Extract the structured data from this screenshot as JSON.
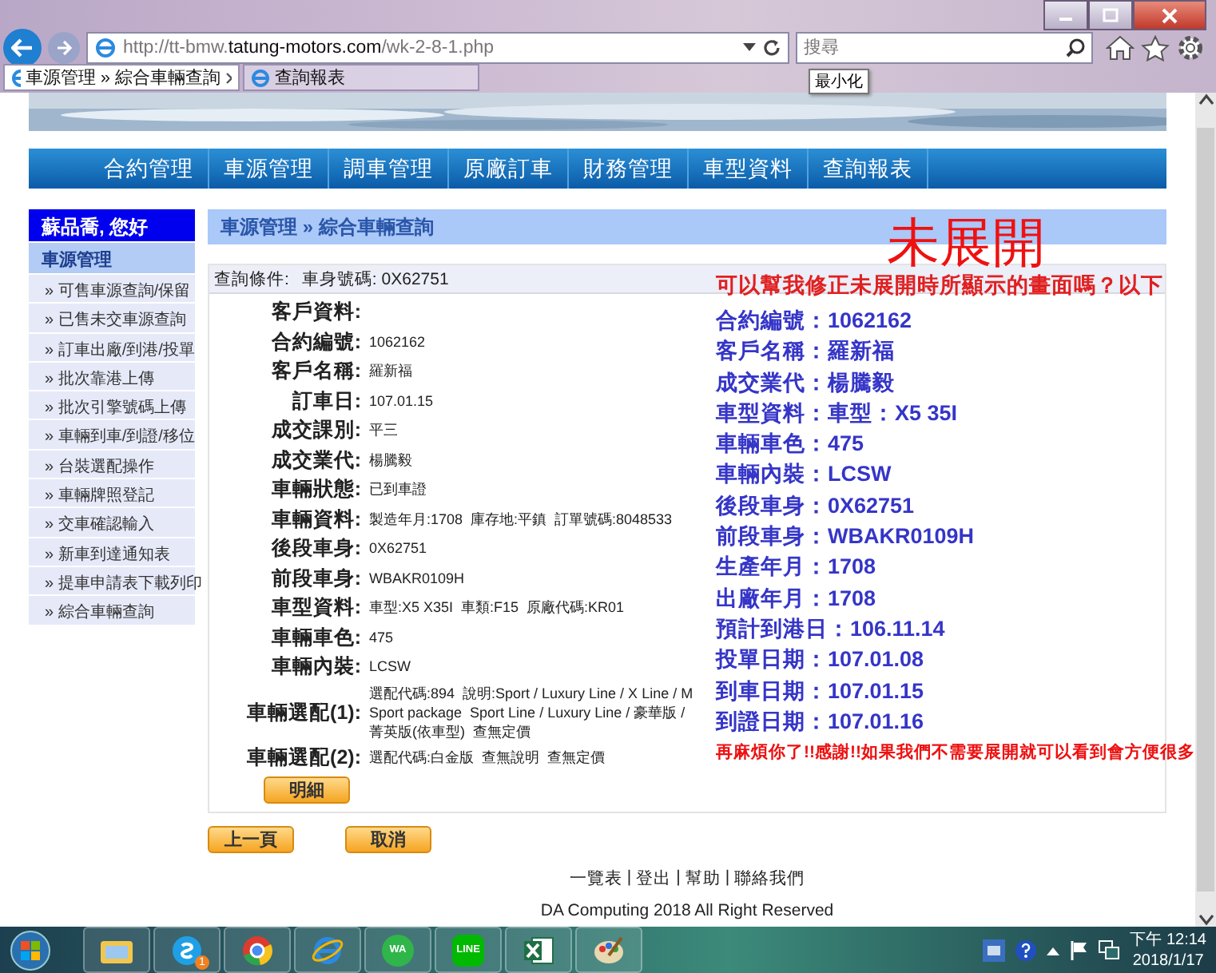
{
  "browser": {
    "url": "http://tt-bmw.**tatung-motors.com**/wk-2-8-1.php",
    "search": {
      "placeholder": "搜尋"
    },
    "tooltip": "最小化",
    "tabs": [
      {
        "label": "車源管理 » 綜合車輛查詢",
        "selected": true
      },
      {
        "label": "查詢報表",
        "selected": false
      }
    ]
  },
  "nav": [
    "合約管理",
    "車源管理",
    "調車管理",
    "原廠訂車",
    "財務管理",
    "車型資料",
    "查詢報表"
  ],
  "sidebar": {
    "greeting": "蘇品喬, 您好",
    "section": "車源管理",
    "items": [
      "» 可售車源查詢/保留",
      "» 已售未交車源查詢",
      "» 訂車出廠/到港/投單",
      "» 批次靠港上傳",
      "» 批次引擎號碼上傳",
      "» 車輛到車/到證/移位",
      "» 台裝選配操作",
      "» 車輛牌照登記",
      "» 交車確認輸入",
      "» 新車到達通知表",
      "» 提車申請表下載列印",
      "» 綜合車輛查詢"
    ]
  },
  "breadcrumb": "車源管理 » 綜合車輛查詢",
  "query": {
    "label": "查詢條件:",
    "value": "車身號碼: 0X62751"
  },
  "fields": [
    {
      "label": "客戶資料:"
    },
    {
      "label": "合約編號:",
      "value": "1062162"
    },
    {
      "label": "客戶名稱:",
      "value": "羅新福"
    },
    {
      "label": "訂車日:",
      "value": "107.01.15"
    },
    {
      "label": "成交課別:",
      "value": "平三"
    },
    {
      "label": "成交業代:",
      "value": "楊騰毅"
    },
    {
      "label": "車輛狀態:",
      "value": "已到車證"
    },
    {
      "label": "車輛資料:",
      "value": "製造年月:1708  庫存地:平鎮  訂單號碼:8048533"
    },
    {
      "label": "後段車身:",
      "value": "0X62751"
    },
    {
      "label": "前段車身:",
      "value": "WBAKR0109H"
    },
    {
      "label": "車型資料:",
      "value": "車型:X5 X35I  車類:F15  原廠代碼:KR01"
    },
    {
      "label": "車輛車色:",
      "value": "475"
    },
    {
      "label": "車輛內裝:",
      "value": "LCSW"
    },
    {
      "label": "車輛選配(1):",
      "value": "選配代碼:894  說明:Sport / Luxury Line / X Line / M Sport package  Sport Line / Luxury Line / 豪華版 / 菁英版(依車型)  查無定價"
    },
    {
      "label": "車輛選配(2):",
      "value": "選配代碼:白金版  查無說明  查無定價"
    }
  ],
  "detail_button": "明細",
  "buttons": [
    "上一頁",
    "取消"
  ],
  "footer_links": [
    "一覽表",
    "登出",
    "幫助",
    "聯絡我們"
  ],
  "footer_separator": "|",
  "copyright": "DA Computing 2018 All Right Reserved",
  "annotation": {
    "title": "未展開",
    "question": "可以幫我修正未展開時所顯示的畫面嗎？以下",
    "lines": [
      "合約編號：1062162",
      "客戶名稱：羅新福",
      "成交業代：楊騰毅",
      "車型資料：車型：X5 35I",
      "車輛車色：475",
      "車輛內裝：LCSW",
      "後段車身：0X62751",
      "前段車身：WBAKR0109H",
      "生產年月：1708",
      "出廠年月：1708",
      "預計到港日：106.11.14",
      "投單日期：107.01.08",
      "到車日期：107.01.15",
      "到證日期：107.01.16"
    ],
    "closing": "再麻煩你了!!感謝!!如果我們不需要展開就可以看到會方便很多"
  },
  "taskbar": {
    "apps": [
      {
        "kind": "explorer"
      },
      {
        "kind": "skype",
        "badge": "1"
      },
      {
        "kind": "chrome"
      },
      {
        "kind": "ie"
      },
      {
        "kind": "whatsapp",
        "label": "WA"
      },
      {
        "kind": "line",
        "label": "LINE"
      },
      {
        "kind": "excel"
      },
      {
        "kind": "paint"
      }
    ],
    "time": "下午 12:14",
    "date": "2018/1/17"
  }
}
